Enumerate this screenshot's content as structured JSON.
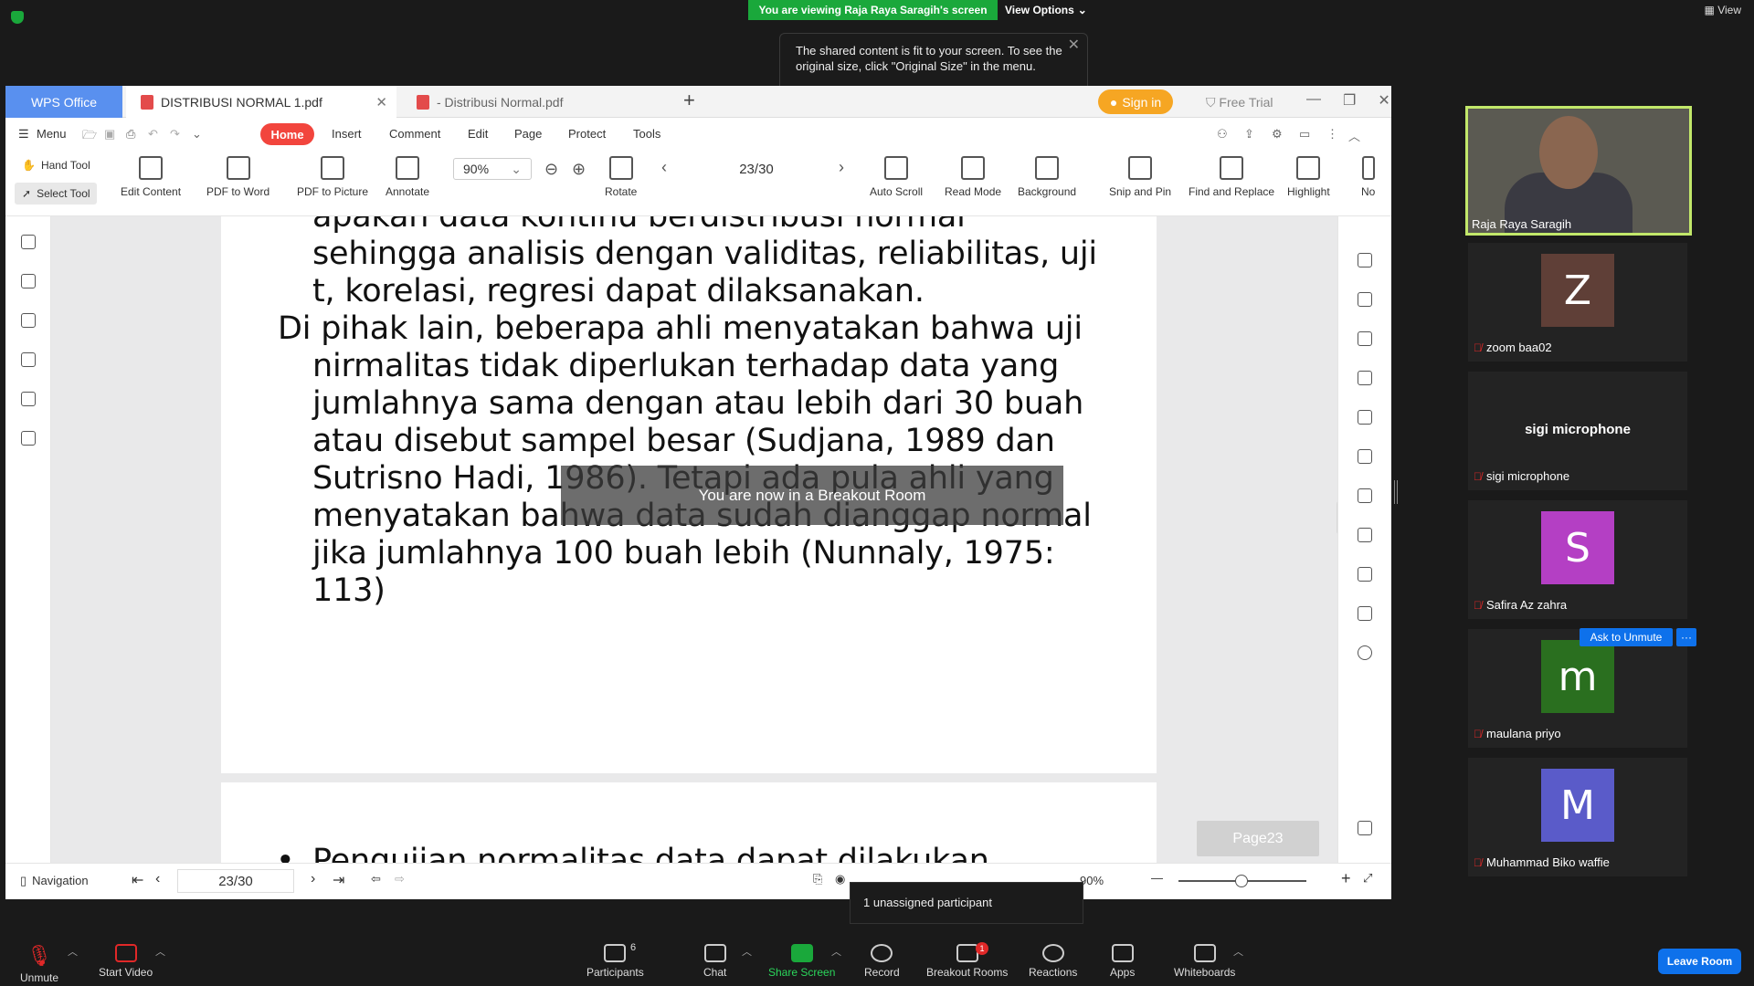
{
  "zoom": {
    "viewing_banner": "You are viewing Raja Raya Saragih's screen",
    "view_options": "View Options",
    "view_label": "View",
    "tooltip": "The shared content is fit to your screen. To see the original size, click \"Original Size\" in the menu.",
    "unassigned": "1 unassigned participant",
    "toolbar": {
      "unmute": "Unmute",
      "start_video": "Start Video",
      "participants": "Participants",
      "participants_count": "6",
      "chat": "Chat",
      "share_screen": "Share Screen",
      "record": "Record",
      "breakout_rooms": "Breakout Rooms",
      "breakout_badge": "1",
      "reactions": "Reactions",
      "apps": "Apps",
      "whiteboards": "Whiteboards",
      "leave_room": "Leave Room"
    },
    "participants": [
      {
        "name": "Raja Raya Saragih",
        "type": "video"
      },
      {
        "name": "zoom baa02",
        "initial": "Z",
        "color": "#5f3f37"
      },
      {
        "name": "sigi microphone",
        "initial": "sigi microphone",
        "color": "#232323"
      },
      {
        "name": "Safira Az zahra",
        "initial": "S",
        "color": "#b43fc4"
      },
      {
        "name": "maulana priyo",
        "initial": "m",
        "color": "#2a6f1f"
      },
      {
        "name": "Muhammad Biko waffie",
        "initial": "M",
        "color": "#5a5bc9"
      }
    ],
    "ask_to_unmute": "Ask to Unmute",
    "more": "···"
  },
  "wps": {
    "app_tab": "WPS Office",
    "doc_tab_active": "DISTRIBUSI NORMAL 1.pdf",
    "doc_tab_2": "- Distribusi Normal.pdf",
    "sign_in": "Sign in",
    "free_trial": "Free Trial",
    "menu": [
      "Menu",
      "Home",
      "Insert",
      "Comment",
      "Edit",
      "Page",
      "Protect",
      "Tools"
    ],
    "ribbon": {
      "hand_tool": "Hand Tool",
      "select_tool": "Select Tool",
      "edit_content": "Edit Content",
      "pdf_to_word": "PDF to Word",
      "pdf_to_picture": "PDF to Picture",
      "annotate": "Annotate",
      "zoom": "90%",
      "page": "23/30",
      "rotate": "Rotate",
      "auto_scroll": "Auto Scroll",
      "read_mode": "Read Mode",
      "background": "Background",
      "snip_and_pin": "Snip and Pin",
      "find_and_replace": "Find and Replace",
      "highlight": "Highlight",
      "no": "No"
    },
    "document": {
      "lines": [
        "apakah data kontinu berdistribusi normal",
        "sehingga analisis dengan validitas, reliabilitas, uji",
        "t, korelasi, regresi dapat dilaksanakan.",
        "Di pihak lain, beberapa ahli menyatakan bahwa uji",
        "nirmalitas tidak diperlukan terhadap data yang",
        "jumlahnya sama dengan atau lebih dari 30 buah",
        "atau disebut sampel besar (Sudjana, 1989 dan",
        "Sutrisno Hadi, 1986). Tetapi ada pula ahli yang",
        "menyatakan bahwa data sudah dianggap normal",
        "jika jumlahnya 100 buah lebih (Nunnaly, 1975:",
        "113)"
      ],
      "page2_bullet": "•",
      "page2_line": "Pengujian normalitas data dapat dilakukan"
    },
    "breakout_overlay": "You are now in a Breakout Room",
    "page_badge": "Page23",
    "status": {
      "navigation": "Navigation",
      "page": "23/30",
      "zoom": "90%"
    }
  }
}
